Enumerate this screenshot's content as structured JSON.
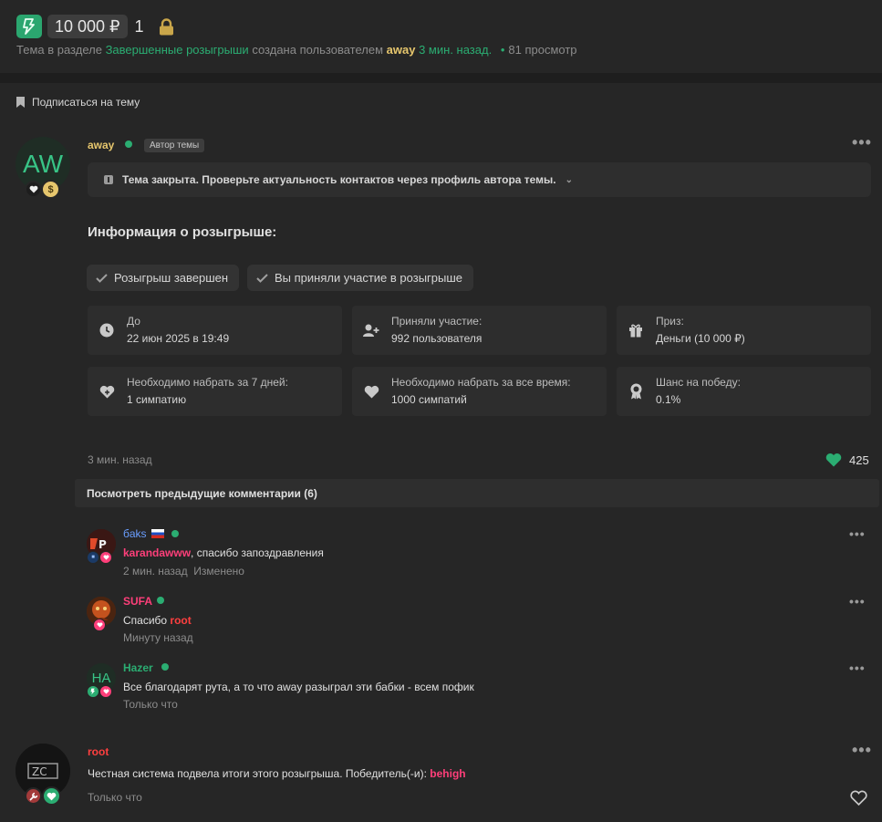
{
  "thread": {
    "amount": "10 000 ₽",
    "count": "1",
    "meta_prefix": "Тема в разделе",
    "meta_section": "Завершенные розыгрыши",
    "meta_created_by": "создана пользователем",
    "meta_author": "away",
    "meta_time": "3 мин. назад.",
    "meta_views": "81 просмотр",
    "subscribe_label": "Подписаться на тему"
  },
  "post": {
    "avatar_text": "AW",
    "author": "away",
    "author_tag": "Автор темы",
    "closed_notice": "Тема закрыта. Проверьте актуальность контактов через профиль автора темы.",
    "info_title": "Информация о розыгрыше:",
    "pills": [
      "Розыгрыш завершен",
      "Вы приняли участие в розыгрыше"
    ],
    "cards": [
      {
        "icon": "clock-icon",
        "label": "До",
        "value": "22 июн 2025 в 19:49"
      },
      {
        "icon": "user-plus-icon",
        "label": "Приняли участие:",
        "value": "992 пользователя"
      },
      {
        "icon": "gift-icon",
        "label": "Приз:",
        "value": "Деньги (10 000 ₽)"
      },
      {
        "icon": "heart-plus-icon",
        "label": "Необходимо набрать за 7 дней:",
        "value": "1 симпатию"
      },
      {
        "icon": "heart-icon",
        "label": "Необходимо набрать за все время:",
        "value": "1000 симпатий"
      },
      {
        "icon": "medal-icon",
        "label": "Шанс на победу:",
        "value": "0.1%"
      }
    ],
    "time": "3 мин. назад",
    "likes": "425",
    "prev_comments_label": "Посмотреть предыдущие комментарии (6)"
  },
  "comments": [
    {
      "name": "бaks",
      "mention": "karandawww",
      "text": ", спасибо запоздравления",
      "time": "2 мин. назад",
      "edited": "Изменено",
      "avatar_text": "LP"
    },
    {
      "name": "SUFA",
      "text": "Спасибо ",
      "mention": "root",
      "time": "Минуту назад"
    },
    {
      "name": "Hazer",
      "text": "Все благодарят рута, а то что away разыграл эти бабки - всем пофик",
      "time": "Только что",
      "avatar_text": "HA"
    }
  ],
  "root_post": {
    "name": "root",
    "avatar_text": "ZC",
    "text": "Честная система подвела итоги этого розыгрыша. Победитель(-и): ",
    "winner": "behigh",
    "time": "Только что"
  },
  "colors": {
    "accent_green": "#2bad72",
    "gold": "#e6c66d",
    "pink": "#ff3f7a",
    "red": "#ff3f3f",
    "blue": "#6a9eff"
  }
}
